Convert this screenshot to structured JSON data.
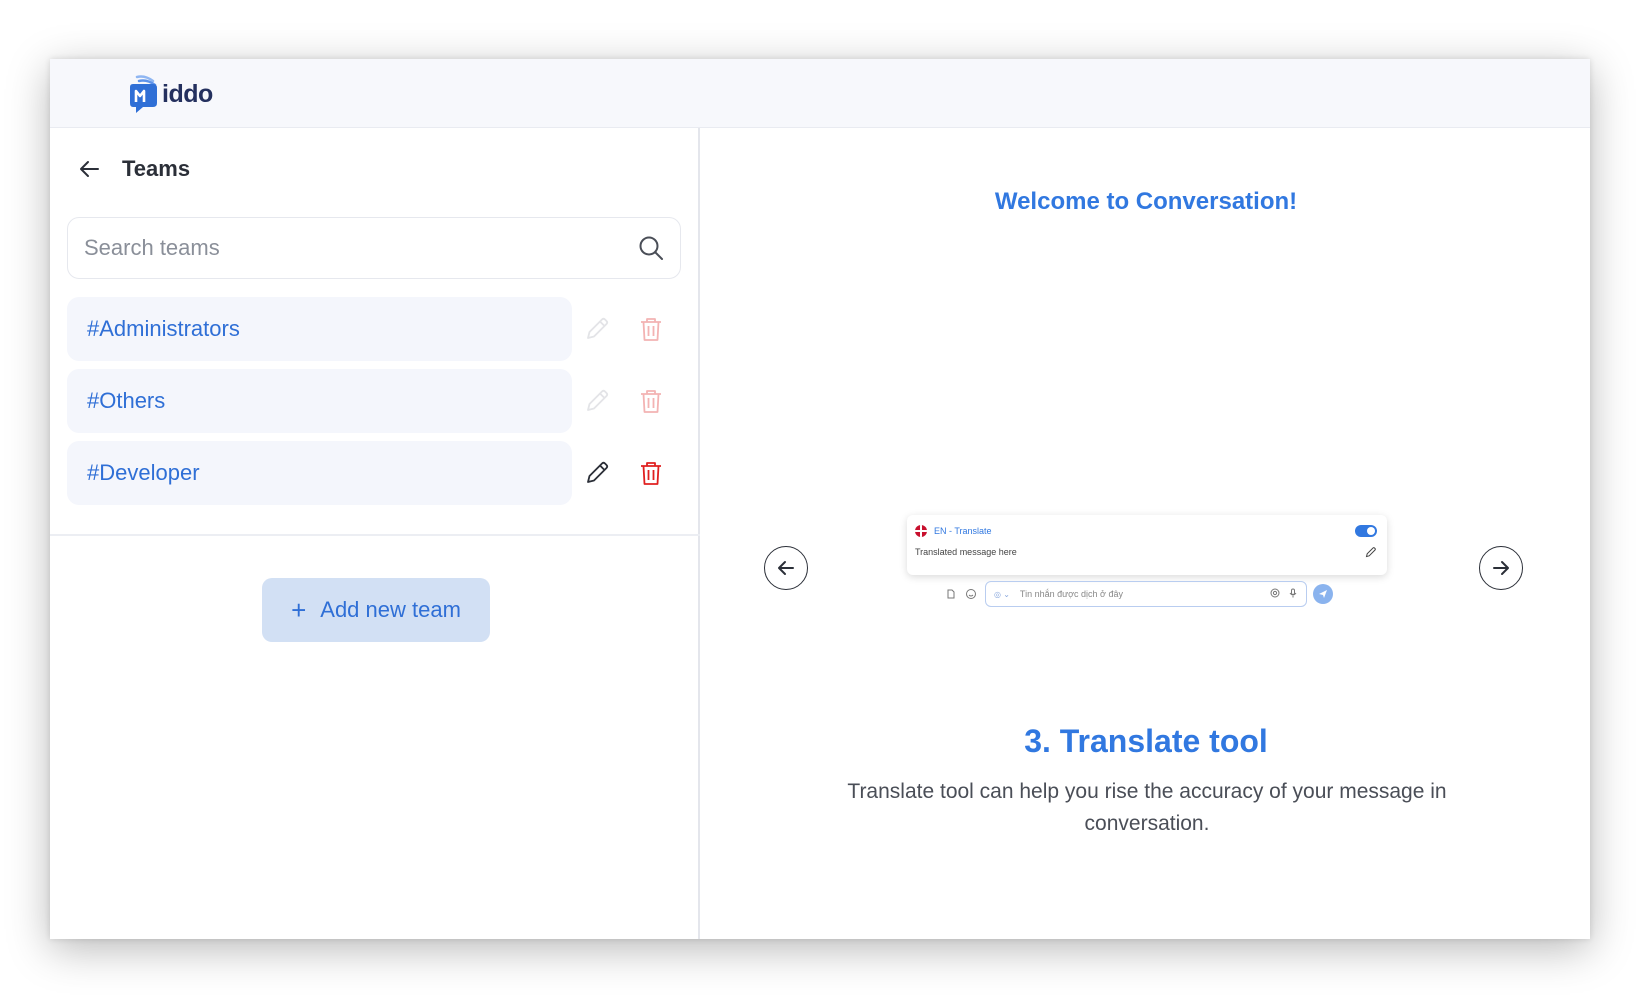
{
  "brand": {
    "logo_text": "iddo"
  },
  "teams_panel": {
    "title": "Teams",
    "search": {
      "placeholder": "Search teams",
      "value": ""
    },
    "teams": [
      {
        "name": "#Administrators",
        "enabled": false
      },
      {
        "name": "#Others",
        "enabled": false
      },
      {
        "name": "#Developer",
        "enabled": true
      }
    ],
    "add_button_label": "Add new team",
    "add_button_icon": "+"
  },
  "onboarding": {
    "welcome": "Welcome to Conversation!",
    "slide_title": "3. Translate tool",
    "slide_description": "Translate tool can help you rise the accuracy of your message in conversation.",
    "preview": {
      "lang_label": "EN - Translate",
      "translated_text": "Translated message here",
      "input_placeholder": "Tin nhắn được dịch ở đây",
      "translate_on": true
    }
  },
  "colors": {
    "accent": "#3178e0",
    "team_text": "#2f6fd6",
    "delete_active": "#e02020",
    "delete_disabled": "#f3b3b3",
    "add_button_bg": "#d2e0f4"
  }
}
